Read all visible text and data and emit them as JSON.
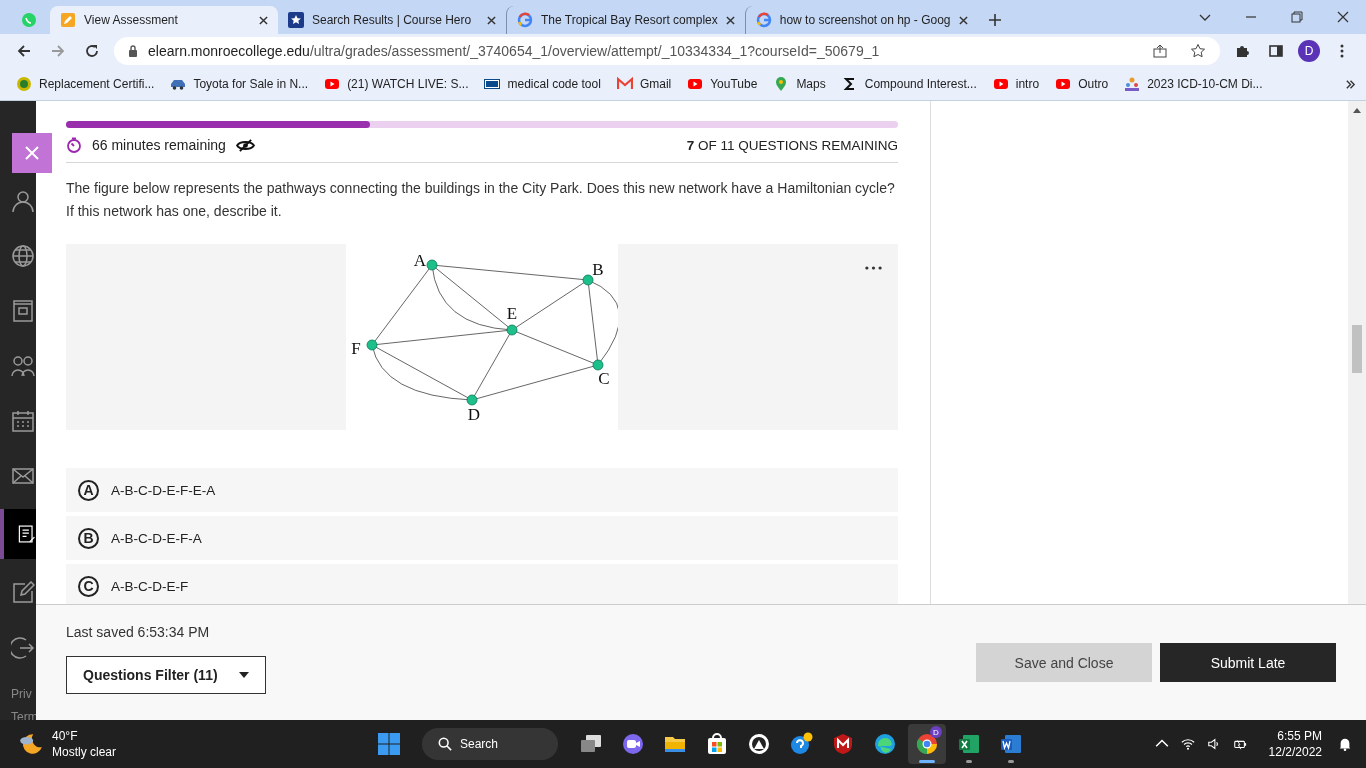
{
  "browser": {
    "tabs": [
      {
        "kind": "whatsapp",
        "selected": false,
        "pinned": true
      },
      {
        "kind": "pencil",
        "title": "View Assessment",
        "selected": true,
        "pinned": false
      },
      {
        "kind": "star",
        "title": "Search Results | Course Hero",
        "selected": false,
        "pinned": false
      },
      {
        "kind": "google",
        "title": "The Tropical Bay Resort complex",
        "selected": false,
        "pinned": false
      },
      {
        "kind": "google",
        "title": "how to screenshot on hp - Goog",
        "selected": false,
        "pinned": false
      }
    ],
    "url_host": "elearn.monroecollege.edu",
    "url_path": "/ultra/grades/assessment/_3740654_1/overview/attempt/_10334334_1?courseId=_50679_1",
    "profile": "D",
    "bookmarks": [
      {
        "kind": "badge",
        "label": "Replacement Certifi..."
      },
      {
        "kind": "car",
        "label": "Toyota for Sale in N..."
      },
      {
        "kind": "video",
        "label": "(21) WATCH LIVE: S..."
      },
      {
        "kind": "agency",
        "label": "medical code tool"
      },
      {
        "kind": "mail",
        "label": "Gmail"
      },
      {
        "kind": "video",
        "label": "YouTube"
      },
      {
        "kind": "pin",
        "label": "Maps"
      },
      {
        "kind": "sigma",
        "label": "Compound Interest..."
      },
      {
        "kind": "video",
        "label": "intro"
      },
      {
        "kind": "video",
        "label": "Outro"
      },
      {
        "kind": "people",
        "label": "2023 ICD-10-CM Di..."
      }
    ]
  },
  "sidebar": {
    "items": [
      {
        "kind": "user",
        "selected": false
      },
      {
        "kind": "globe",
        "selected": false
      },
      {
        "kind": "building",
        "selected": false
      },
      {
        "kind": "people",
        "selected": false
      },
      {
        "kind": "calendar",
        "selected": false
      },
      {
        "kind": "mail",
        "selected": false
      },
      {
        "kind": "grades",
        "selected": true
      },
      {
        "kind": "edit",
        "selected": false
      },
      {
        "kind": "signout",
        "selected": false
      }
    ],
    "footer_links": [
      "Priv",
      "Term"
    ]
  },
  "assessment": {
    "progress": {
      "level": 0.365
    },
    "time_remaining": "66 minutes remaining",
    "questions_remaining": "**7** OF 11 QUESTIONS REMAINING",
    "question": "The figure below represents the pathways connecting the buildings in the City Park.  Does this new network have a Hamiltonian cycle? If this network has one, describe it.",
    "graph": {
      "nodes": [
        {
          "label": "A"
        },
        {
          "label": "B"
        },
        {
          "label": "E"
        },
        {
          "label": "F"
        },
        {
          "label": "C"
        },
        {
          "label": "D"
        }
      ]
    },
    "options": [
      {
        "letter": "A",
        "text": "A-B-C-D-E-F-E-A",
        "selected": false
      },
      {
        "letter": "B",
        "text": "A-B-C-D-E-F-A",
        "selected": false
      },
      {
        "letter": "C",
        "text": "A-B-C-D-E-F",
        "selected": false
      }
    ],
    "last_saved": "Last saved 6:53:34 PM",
    "filter": "Questions Filter (11)",
    "buttons": [
      {
        "kind": "secondary",
        "label": "Save and Close"
      },
      {
        "kind": "primary",
        "label": "Submit Late"
      }
    ]
  },
  "taskbar": {
    "weather_temp": "40°F",
    "weather_text": "Mostly clear",
    "search": "Search",
    "apps": [
      {
        "kind": "windows",
        "running": false
      },
      {
        "kind": "search"
      },
      {
        "kind": "tasks",
        "running": false
      },
      {
        "kind": "chat",
        "running": false
      },
      {
        "kind": "folder",
        "running": false
      },
      {
        "kind": "store",
        "running": false
      },
      {
        "kind": "circle",
        "running": false
      },
      {
        "kind": "help",
        "running": false
      },
      {
        "kind": "shield",
        "running": false
      },
      {
        "kind": "edge",
        "running": false
      },
      {
        "kind": "chrome",
        "running": true
      },
      {
        "kind": "excel",
        "running": true
      },
      {
        "kind": "word",
        "running": true
      }
    ],
    "chrome_badge": "D",
    "time": "6:55 PM",
    "date": "12/2/2022"
  }
}
